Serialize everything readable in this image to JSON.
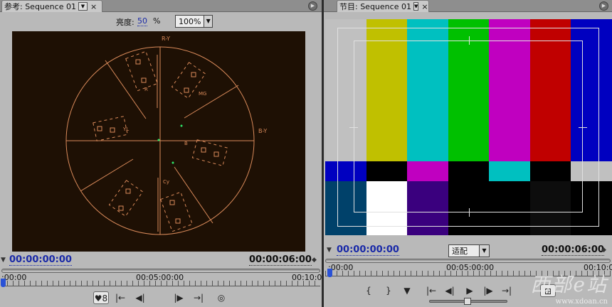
{
  "reference_monitor": {
    "tab_label": "参考: Sequence 01",
    "close_glyph": "×",
    "brightness_label": "亮度:",
    "brightness_value": "50",
    "brightness_unit": "%",
    "zoom_value": "100%",
    "vectorscope_labels": {
      "r_y": "R-Y",
      "b_y": "B-Y",
      "r": "R",
      "mg": "MG",
      "yl": "YL",
      "b": "B",
      "cy": "Cy"
    },
    "current_timecode": "00:00:00:00",
    "duration_timecode": "00:00:06:00",
    "ruler_start": ":00:00",
    "ruler_mid": "00:05:00:00",
    "ruler_end": "00:10:0",
    "controls": [
      "gang-toggle",
      "step-back-to-in",
      "step-back",
      "step-forward",
      "step-forward-to-out",
      "output"
    ]
  },
  "program_monitor": {
    "tab_label": "节目: Sequence 01",
    "close_glyph": "×",
    "current_timecode": "00:00:00:00",
    "fit_value": "适配",
    "duration_timecode": "00:00:06:00",
    "ruler_start": ":00:00",
    "ruler_mid": "00:05:00:00",
    "ruler_end": "00:10:0",
    "color_bars": [
      "#c0c0c0",
      "#c0c000",
      "#00c0c0",
      "#00c000",
      "#c000c0",
      "#c00000",
      "#0000c0"
    ],
    "mid_bars": [
      "#0000c0",
      "#000000",
      "#c000c0",
      "#000000",
      "#00c0c0",
      "#000000",
      "#c0c0c0"
    ],
    "bottom_bars": [
      "#00416a",
      "#ffffff",
      "#3a007e",
      "#000000",
      "#000000",
      "#0d0d0d",
      "#000000"
    ]
  },
  "watermark": {
    "brand": "西部e站",
    "url": "www.xdoan.cn"
  },
  "colors": {
    "vectorscope_line": "#d98a5a",
    "screen_bg": "#1e1004",
    "accent_timecode": "#1a2aa8"
  }
}
